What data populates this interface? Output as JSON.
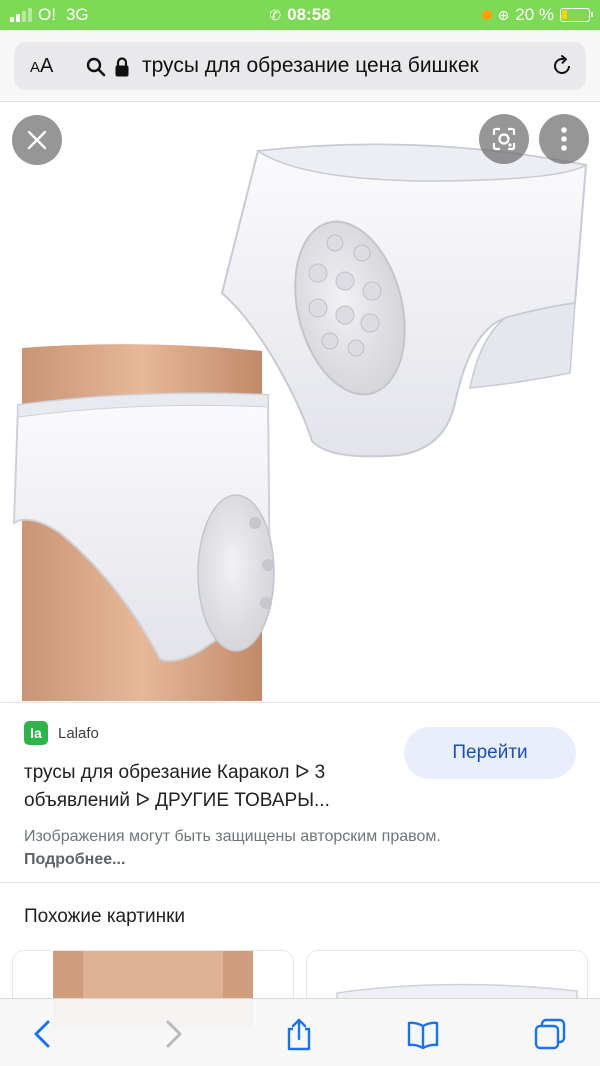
{
  "status_bar": {
    "carrier": "O!",
    "network": "3G",
    "time": "08:58",
    "battery": "20 %",
    "battery_level": 0.2
  },
  "browser": {
    "text_size_label": "AA",
    "url": "трусы для обрезание цена бишкек"
  },
  "result": {
    "source": "Lalafo",
    "favicon_text": "la",
    "go_button": "Перейти",
    "title": "трусы для обрезание Каракол ᐅ 3 объявлений ᐅ ДРУГИЕ ТОВАРЫ...",
    "copyright": "Изображения могут быть защищены авторским правом.",
    "more_link": "Подробнее..."
  },
  "similar": {
    "heading": "Похожие картинки"
  },
  "colors": {
    "status_bar": "#7ed957",
    "accent_blue": "#1a4fb4",
    "button_bg": "#e8eefb",
    "favicon_green": "#2fb34a"
  },
  "icons": {
    "toolbar": [
      "back-icon",
      "forward-icon",
      "share-icon",
      "bookmarks-icon",
      "tabs-icon"
    ],
    "viewer": [
      "close-icon",
      "lens-icon",
      "more-vertical-icon"
    ]
  }
}
